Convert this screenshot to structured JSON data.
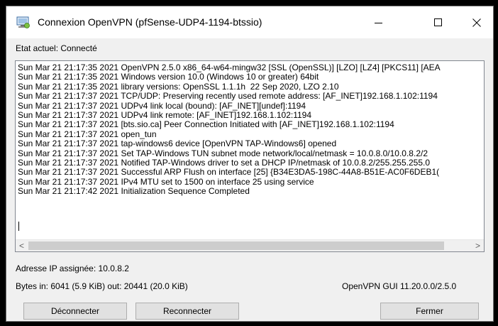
{
  "window": {
    "title": "Connexion OpenVPN (pfSense-UDP4-1194-btssio)",
    "controls": {
      "minimize": "—",
      "maximize": "☐",
      "close": "✕"
    }
  },
  "status_label": "Etat actuel: Connecté",
  "log": {
    "lines": [
      "Sun Mar 21 21:17:35 2021 OpenVPN 2.5.0 x86_64-w64-mingw32 [SSL (OpenSSL)] [LZO] [LZ4] [PKCS11] [AEA",
      "Sun Mar 21 21:17:35 2021 Windows version 10.0 (Windows 10 or greater) 64bit",
      "Sun Mar 21 21:17:35 2021 library versions: OpenSSL 1.1.1h  22 Sep 2020, LZO 2.10",
      "Sun Mar 21 21:17:37 2021 TCP/UDP: Preserving recently used remote address: [AF_INET]192.168.1.102:1194",
      "Sun Mar 21 21:17:37 2021 UDPv4 link local (bound): [AF_INET][undef]:1194",
      "Sun Mar 21 21:17:37 2021 UDPv4 link remote: [AF_INET]192.168.1.102:1194",
      "Sun Mar 21 21:17:37 2021 [bts.sio.ca] Peer Connection Initiated with [AF_INET]192.168.1.102:1194",
      "Sun Mar 21 21:17:37 2021 open_tun",
      "Sun Mar 21 21:17:37 2021 tap-windows6 device [OpenVPN TAP-Windows6] opened",
      "Sun Mar 21 21:17:37 2021 Set TAP-Windows TUN subnet mode network/local/netmask = 10.0.8.0/10.0.8.2/2",
      "Sun Mar 21 21:17:37 2021 Notified TAP-Windows driver to set a DHCP IP/netmask of 10.0.8.2/255.255.255.0",
      "Sun Mar 21 21:17:37 2021 Successful ARP Flush on interface [25] {B34E3DA5-198C-44A8-B51E-AC0F6DEB1(",
      "Sun Mar 21 21:17:37 2021 IPv4 MTU set to 1500 on interface 25 using service",
      "Sun Mar 21 21:17:42 2021 Initialization Sequence Completed"
    ]
  },
  "scroll": {
    "left": "<",
    "right": ">"
  },
  "assigned_ip": "Adresse IP assignée: 10.0.8.2",
  "bytes": "Bytes in: 6041 (5.9 KiB)  out: 20441 (20.0 KiB)",
  "version": "OpenVPN GUI 11.20.0.0/2.5.0",
  "buttons": {
    "disconnect": "Déconnecter",
    "reconnect": "Reconnecter",
    "close": "Fermer"
  }
}
